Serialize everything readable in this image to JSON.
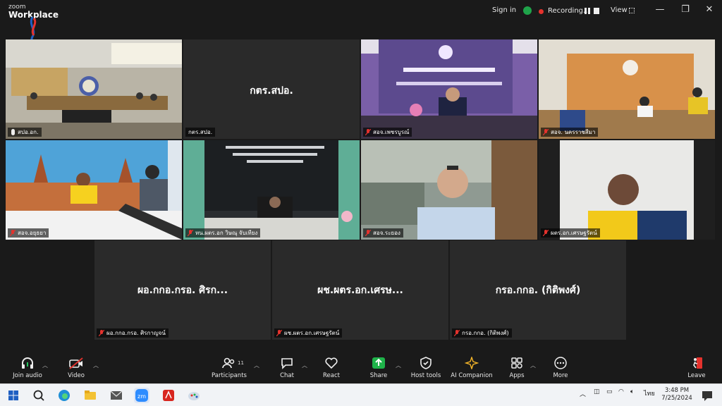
{
  "titlebar": {
    "brand_top": "zoom",
    "brand_bottom": "Workplace",
    "sign_in": "Sign in",
    "recording": "Recording...",
    "view": "View"
  },
  "tiles": [
    {
      "name": "สปอ.อก.",
      "big": "",
      "mic_muted": false,
      "active": true
    },
    {
      "name": "กตร.สปอ.",
      "big": "กตร.สปอ.",
      "mic_muted": false
    },
    {
      "name": "สอจ.เพชรบูรณ์",
      "big": "",
      "mic_muted": true,
      "sign_en": "Phetchabun Provincial Industrial Office",
      "sign_top": "MIND"
    },
    {
      "name": "สอจ. นครราชสีมา",
      "big": "",
      "mic_muted": true
    },
    {
      "name": "สอจ.อยุธยา",
      "big": "",
      "mic_muted": true
    },
    {
      "name": "หน.ผตร.อก วิษณุ จับเทียง",
      "big": "",
      "mic_muted": true
    },
    {
      "name": "สอจ.ระยอง",
      "big": "",
      "mic_muted": true
    },
    {
      "name": "ผตร.อก.เศรษฐรัตน์",
      "big": "",
      "mic_muted": true
    },
    {
      "name": "ผอ.กกอ.กรอ. ศิรกาญจน์",
      "big": "ผอ.กกอ.กรอ. ศิรก...",
      "mic_muted": true
    },
    {
      "name": "ผช.ผตร.อก.เศรษฐรัตน์",
      "big": "ผช.ผตร.อก.เศรษ...",
      "mic_muted": true
    },
    {
      "name": "กรอ.กกอ. (กิติพงศ์)",
      "big": "กรอ.กกอ. (กิติพงศ์)",
      "mic_muted": true
    }
  ],
  "toolbar": {
    "join_audio": "Join audio",
    "video": "Video",
    "participants": "Participants",
    "participants_count": "11",
    "chat": "Chat",
    "react": "React",
    "share": "Share",
    "host_tools": "Host tools",
    "ai_companion": "AI Companion",
    "apps": "Apps",
    "more": "More",
    "leave": "Leave"
  },
  "taskbar": {
    "time": "3:48 PM",
    "date": "7/25/2024",
    "lang": "ไทย"
  },
  "colors": {
    "accent_green": "#23c55e",
    "share_green": "#1fb34a",
    "leave_red": "#e5322d"
  }
}
